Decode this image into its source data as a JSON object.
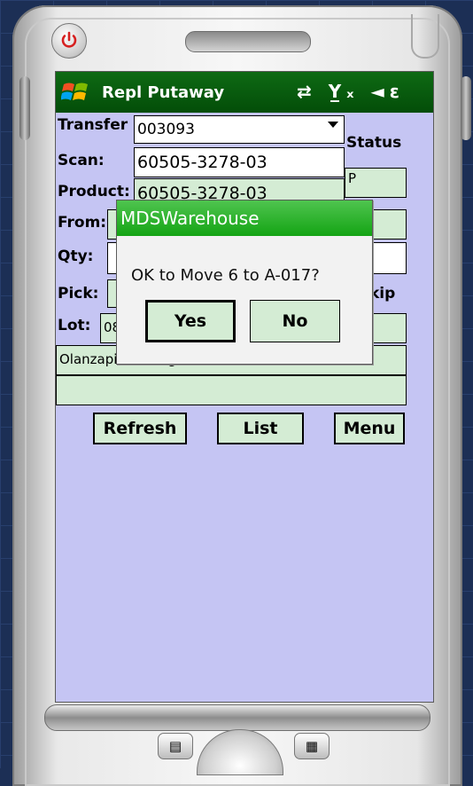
{
  "app": {
    "title": "Repl Putaway",
    "status_icons": "⇄ Y̲ₓ ◄ε"
  },
  "form": {
    "transfer_label": "Transfer",
    "transfer_value": "003093",
    "status_label": "Status",
    "status_value": "P",
    "scan_label": "Scan:",
    "scan_value": "60505-3278-03",
    "product_label": "Product:",
    "product_value": "60505-3278-03",
    "from_label": "From:",
    "from_value": "",
    "qty_label": "Qty:",
    "qty_value": "",
    "pick_label": "Pick:",
    "pick_value": "",
    "skip_label": "kip",
    "lot_label": "Lot:",
    "lot_value": "08",
    "description": "Olanzapine 20mg ODT 30ct",
    "description_line2": ""
  },
  "buttons": {
    "refresh": "Refresh",
    "list": "List",
    "menu": "Menu"
  },
  "dialog": {
    "title": "MDSWarehouse",
    "message": "OK to Move 6 to A-017?",
    "yes": "Yes",
    "no": "No"
  }
}
